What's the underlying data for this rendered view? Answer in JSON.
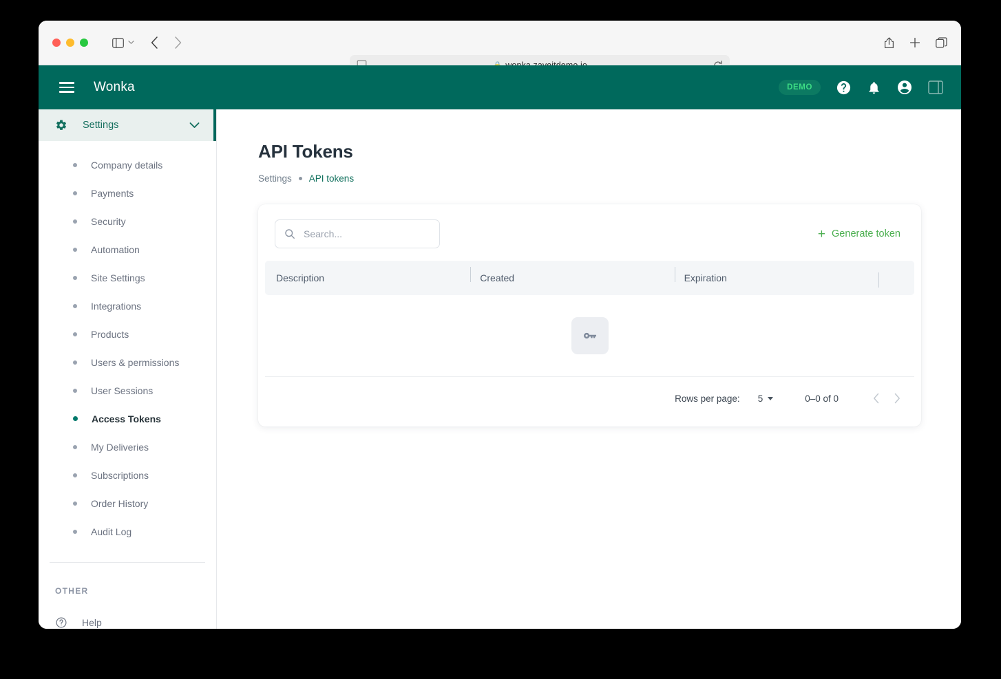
{
  "browser": {
    "url": "wonka.zaveitdemo.io",
    "lock_icon": "lock-icon",
    "sidebar_toggle_icon": "sidebar-toggle-icon",
    "back_icon": "back-arrow-icon",
    "forward_icon": "forward-arrow-icon",
    "reader_icon": "reader-view-icon",
    "reload_icon": "reload-icon",
    "share_icon": "share-icon",
    "new_tab_icon": "plus-icon",
    "tab_overview_icon": "tab-overview-icon"
  },
  "appbar": {
    "brand": "Wonka",
    "menu_icon": "hamburger-menu-icon",
    "demo_badge": "DEMO",
    "help_icon": "help-circle-icon",
    "notifications_icon": "bell-icon",
    "account_icon": "account-circle-icon",
    "panel_icon": "right-panel-icon"
  },
  "sidebar": {
    "section": {
      "label": "Settings",
      "gear_icon": "gear-icon",
      "chevron_icon": "chevron-down-icon"
    },
    "items": [
      {
        "label": "Company details",
        "active": false
      },
      {
        "label": "Payments",
        "active": false
      },
      {
        "label": "Security",
        "active": false
      },
      {
        "label": "Automation",
        "active": false
      },
      {
        "label": "Site Settings",
        "active": false
      },
      {
        "label": "Integrations",
        "active": false
      },
      {
        "label": "Products",
        "active": false
      },
      {
        "label": "Users & permissions",
        "active": false
      },
      {
        "label": "User Sessions",
        "active": false
      },
      {
        "label": "Access Tokens",
        "active": true
      },
      {
        "label": "My Deliveries",
        "active": false
      },
      {
        "label": "Subscriptions",
        "active": false
      },
      {
        "label": "Order History",
        "active": false
      },
      {
        "label": "Audit Log",
        "active": false
      }
    ],
    "other_label": "OTHER",
    "help": {
      "label": "Help",
      "icon": "question-circle-icon"
    }
  },
  "main": {
    "title": "API Tokens",
    "breadcrumb": {
      "parent": "Settings",
      "current": "API tokens"
    },
    "search": {
      "placeholder": "Search...",
      "value": "",
      "icon": "search-icon"
    },
    "generate_button": {
      "label": "Generate token",
      "icon": "plus-icon"
    },
    "table": {
      "columns": [
        "Description",
        "Created",
        "Expiration",
        ""
      ],
      "rows": [],
      "empty_icon": "key-icon"
    },
    "pagination": {
      "rows_per_page_label": "Rows per page:",
      "rows_per_page_value": "5",
      "range": "0–0 of 0",
      "prev_icon": "chevron-left-icon",
      "next_icon": "chevron-right-icon"
    }
  },
  "colors": {
    "appbar_green": "#00695c",
    "accent_green": "#12715e",
    "generate_green": "#4caf50",
    "demo_text": "#3ddc84",
    "sidebar_active_dot": "#00796b"
  }
}
